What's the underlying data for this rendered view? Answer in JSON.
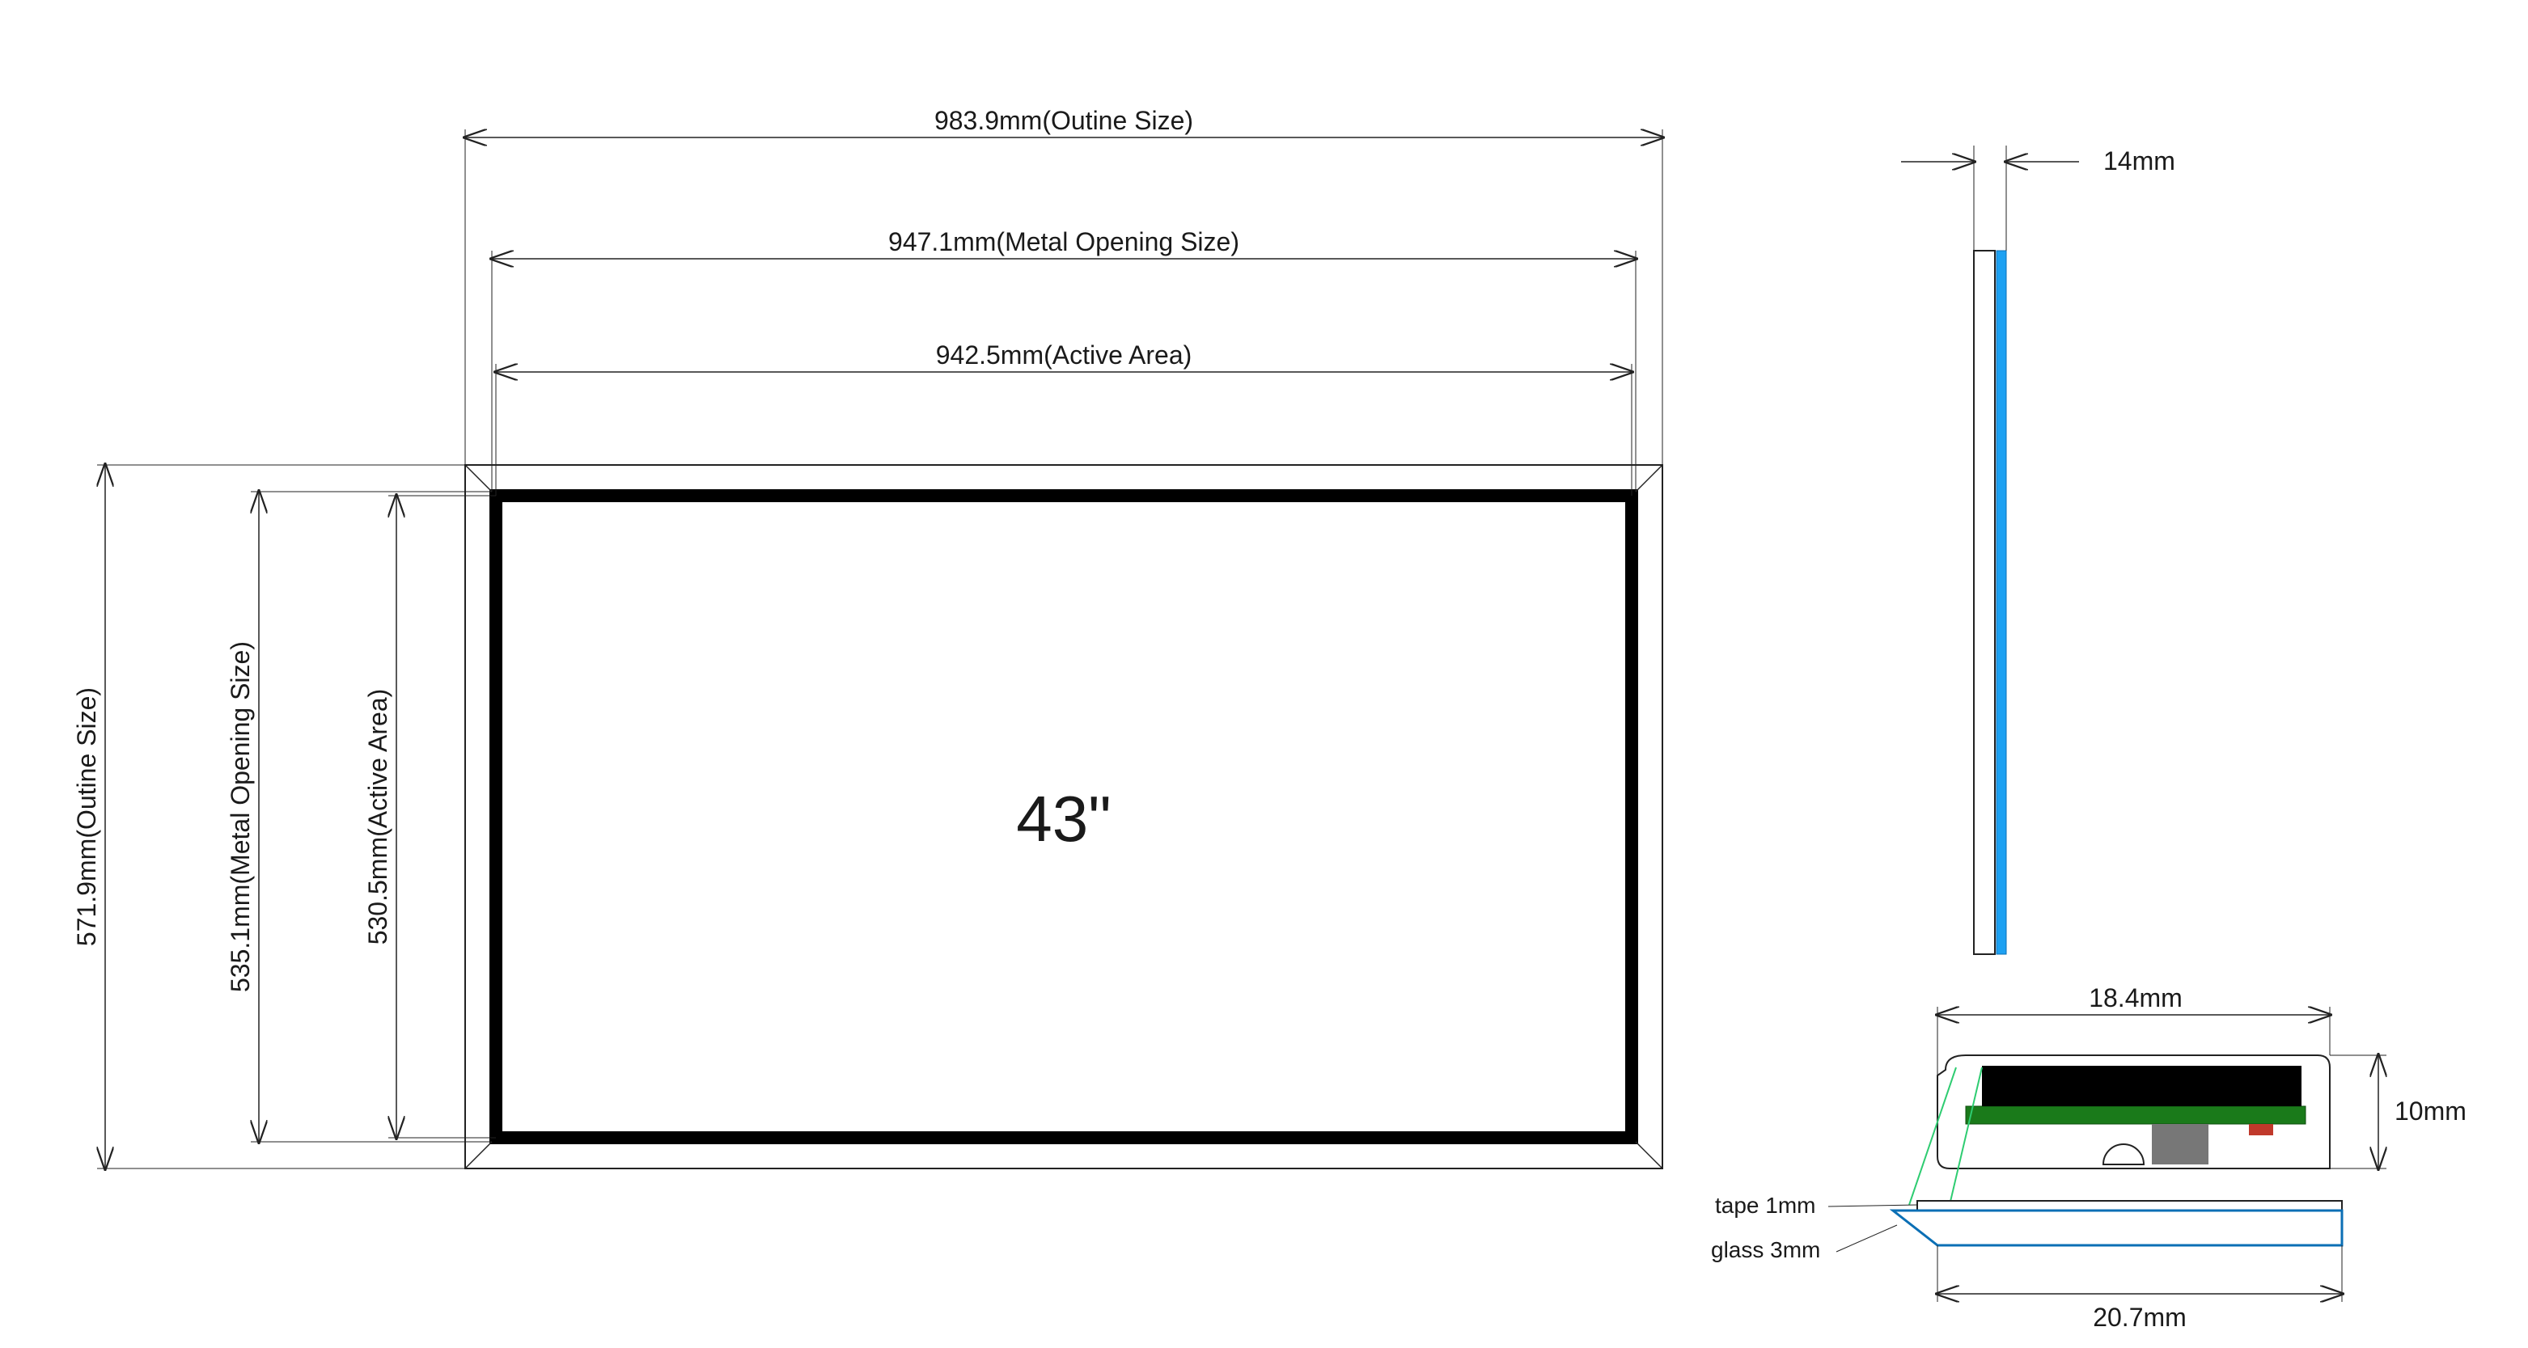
{
  "diagonal": "43\"",
  "front": {
    "width_outline": "983.9mm(Outine Size)",
    "width_opening": "947.1mm(Metal Opening Size)",
    "width_active": "942.5mm(Active Area)",
    "height_outline": "571.9mm(Outine Size)",
    "height_opening": "535.1mm(Metal Opening Size)",
    "height_active": "530.5mm(Active Area)"
  },
  "side": {
    "depth": "14mm"
  },
  "detail": {
    "width_top": "18.4mm",
    "height_right": "10mm",
    "tape": "tape 1mm",
    "glass": "glass 3mm",
    "width_bottom": "20.7mm"
  }
}
